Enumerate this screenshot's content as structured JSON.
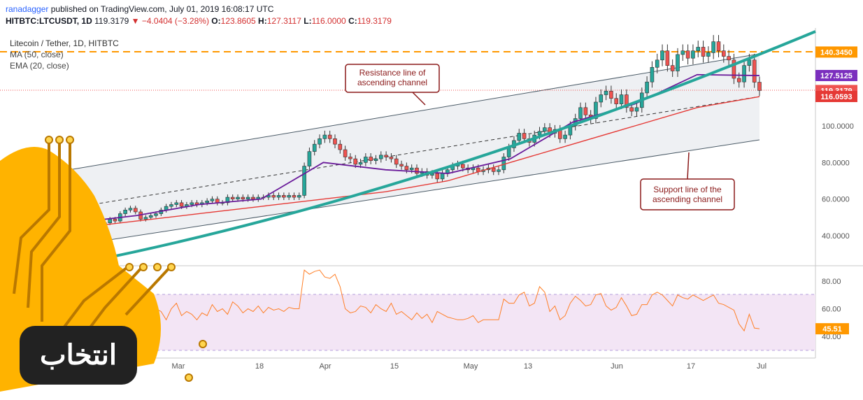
{
  "header": {
    "author": "ranadagger",
    "published": "published on TradingView.com, July 01, 2019 16:08:17 UTC",
    "symbol": "HITBTC:LTCUSDT, 1D",
    "last": "119.3179",
    "arrow": "▼",
    "change": "−4.0404 (−3.28%)",
    "o_label": "O:",
    "o": "123.8605",
    "h_label": "H:",
    "h": "127.3117",
    "l_label": "L:",
    "l": "116.0000",
    "c_label": "C:",
    "c": "119.3179"
  },
  "legend": {
    "title": "Litecoin / Tether, 1D, HITBTC",
    "ma": "MA (50, close)",
    "ema": "EMA (20, close)"
  },
  "annotations": {
    "resistance": [
      "Resistance line of",
      "ascending channel"
    ],
    "support": [
      "Support line of the",
      "ascending channel"
    ]
  },
  "price_badges": [
    {
      "label": "140.3450",
      "color": "#ff9800"
    },
    {
      "label": "127.5125",
      "color": "#7b2fbe"
    },
    {
      "label": "119.3179",
      "color": "#ef5350"
    },
    {
      "label": "116.0593",
      "color": "#e53935"
    }
  ],
  "rsi_badge": {
    "label": "45.51",
    "color": "#ff9800"
  },
  "colors": {
    "up": "#26a69a",
    "down": "#ef5350",
    "ma50": "#e53935",
    "ema20": "#6a1b9a",
    "rsi": "#ff7f27",
    "trend": "#26a69a",
    "horizontal": "#ff9800",
    "annotation": "#8b1a1a"
  },
  "logo": {
    "text": "انتخاب"
  },
  "chart_data": [
    {
      "type": "candlestick",
      "title": "Litecoin / Tether, 1D, HITBTC",
      "xlabel": "",
      "ylabel": "",
      "x_ticks": [
        "Mar",
        "18",
        "Apr",
        "15",
        "May",
        "13",
        "Jun",
        "17",
        "Jul"
      ],
      "y_ticks": [
        "40.0000",
        "60.0000",
        "80.0000",
        "100.0000"
      ],
      "ylim": [
        20,
        155
      ],
      "series": [
        {
          "name": "MA (50, close)",
          "values": [
            44,
            48,
            52,
            56,
            60,
            64,
            70,
            80,
            90,
            100,
            110,
            116
          ]
        },
        {
          "name": "EMA (20, close)",
          "values": [
            47,
            51,
            57,
            60,
            80,
            76,
            74,
            82,
            102,
            112,
            128,
            127.5
          ]
        }
      ],
      "levels": [
        140.345,
        127.5125,
        119.3179,
        116.0593
      ],
      "close": [
        33,
        36,
        43,
        46,
        44,
        46,
        47,
        49,
        48,
        52,
        54,
        55,
        53,
        49,
        50,
        51,
        52,
        54,
        56,
        57,
        58,
        56,
        57,
        58,
        57,
        58,
        59,
        60,
        58,
        58,
        61,
        60,
        61,
        60,
        61,
        60,
        61,
        61,
        62,
        61,
        62,
        61,
        62,
        61,
        62,
        78,
        86,
        90,
        93,
        95,
        93,
        90,
        87,
        83,
        82,
        79,
        80,
        83,
        81,
        82,
        84,
        83,
        82,
        79,
        78,
        76,
        77,
        74,
        75,
        73,
        74,
        71,
        74,
        76,
        78,
        79,
        77,
        76,
        77,
        75,
        76,
        77,
        75,
        76,
        83,
        88,
        92,
        96,
        93,
        91,
        95,
        97,
        99,
        96,
        98,
        93,
        95,
        100,
        104,
        110,
        106,
        104,
        113,
        117,
        119,
        115,
        112,
        117,
        110,
        108,
        110,
        118,
        124,
        132,
        136,
        141,
        133,
        130,
        139,
        141,
        137,
        141,
        143,
        138,
        140,
        146,
        141,
        138,
        136,
        126,
        124,
        133,
        136,
        123.86,
        119.32
      ]
    },
    {
      "type": "line",
      "title": "",
      "ylim": [
        20,
        90
      ],
      "y_ticks": [
        "40.00",
        "60.00",
        "80.00"
      ],
      "bands": [
        30,
        70
      ],
      "values": [
        70,
        68,
        60,
        56,
        57,
        58,
        70,
        67,
        58,
        60,
        64,
        62,
        50,
        58,
        60,
        62,
        60,
        58,
        52,
        60,
        64,
        55,
        58,
        56,
        52,
        57,
        55,
        63,
        58,
        60,
        56,
        65,
        62,
        57,
        60,
        58,
        62,
        57,
        61,
        59,
        60,
        58,
        61,
        60,
        60,
        88,
        85,
        87,
        88,
        83,
        82,
        85,
        76,
        60,
        57,
        58,
        62,
        61,
        57,
        63,
        60,
        58,
        64,
        56,
        58,
        55,
        52,
        57,
        53,
        56,
        50,
        58,
        56,
        54,
        53,
        52,
        52,
        53,
        55,
        50,
        52,
        52,
        52,
        52,
        67,
        64,
        64,
        70,
        72,
        62,
        64,
        76,
        72,
        58,
        62,
        52,
        55,
        64,
        69,
        66,
        62,
        63,
        70,
        71,
        62,
        59,
        61,
        68,
        62,
        55,
        56,
        63,
        63,
        70,
        72,
        70,
        66,
        62,
        70,
        68,
        67,
        70,
        68,
        66,
        68,
        70,
        64,
        63,
        61,
        59,
        49,
        44,
        56,
        46,
        45.51
      ]
    }
  ]
}
